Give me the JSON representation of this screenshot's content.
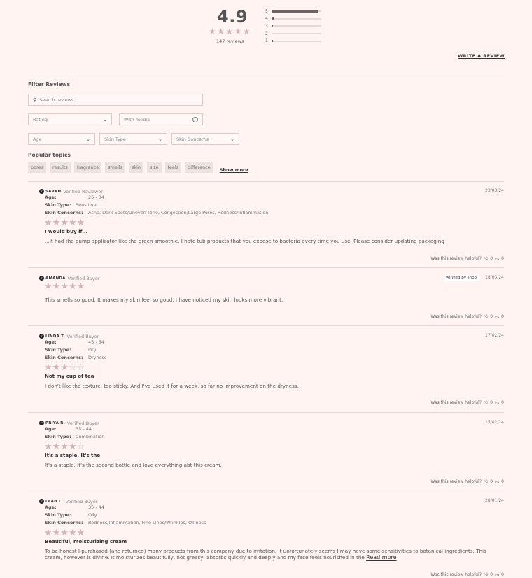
{
  "summary": {
    "score": "4.9",
    "stars": "★★★★★",
    "count": "147 reviews",
    "breakdown": [
      {
        "label": "5",
        "fraction": 0.93
      },
      {
        "label": "4",
        "fraction": 0.04
      },
      {
        "label": "3",
        "fraction": 0.02
      },
      {
        "label": "2",
        "fraction": 0.0
      },
      {
        "label": "1",
        "fraction": 0.01
      }
    ],
    "write_review": "WRITE A REVIEW"
  },
  "filters": {
    "title": "Filter Reviews",
    "search_placeholder": "Search reviews",
    "rating": "Rating",
    "with_media": "With media",
    "age": "Age",
    "skin_type": "Skin Type",
    "skin_concerns": "Skin Concerns"
  },
  "topics": {
    "title": "Popular topics",
    "chips": [
      "pores",
      "results",
      "fragrance",
      "smells",
      "skin",
      "size",
      "feels",
      "difference"
    ],
    "show_more": "Show more"
  },
  "helpful_label": "Was this review helpful?",
  "reviews": [
    {
      "author": "SARAH",
      "badge": "Verified Reviewer",
      "date": "23/03/24",
      "age_label": "Age:",
      "age": "25 - 34",
      "skin_type_label": "Skin Type:",
      "skin_type": "Sensitive",
      "concerns_label": "Skin Concerns:",
      "concerns": "Acne, Dark Spots/Uneven Tone, Congestion/Large Pores, Redness/Inflammation",
      "rating": 5,
      "title": "I would buy if...",
      "body": "...it had the pump applicator like the green smoothie. I hate tub products that you expose to bacteria every time you use. Please consider updating packaging",
      "up": "0",
      "down": "0"
    },
    {
      "author": "AMANDA",
      "badge": "Verified Buyer",
      "date": "18/03/24",
      "shop_badge": "Verified by shop",
      "rating": 5,
      "body": "This smells so good. It makes my skin feel so good. I have noticed my skin looks more vibrant.",
      "up": "0",
      "down": "0"
    },
    {
      "author": "LINDA T.",
      "badge": "Verified Buyer",
      "date": "17/02/24",
      "age_label": "Age:",
      "age": "45 - 54",
      "skin_type_label": "Skin Type:",
      "skin_type": "Dry",
      "concerns_label": "Skin Concerns:",
      "concerns": "Dryness",
      "rating": 3,
      "title": "Not my cup of tea",
      "body": "I don't like the texture, too sticky. And I've used it for a week, so far no improvement on the dryness.",
      "up": "0",
      "down": "0"
    },
    {
      "author": "PRIYA R.",
      "badge": "Verified Buyer",
      "date": "15/02/24",
      "age_label": "Age:",
      "age": "35 - 44",
      "skin_type_label": "Skin Type:",
      "skin_type": "Combination",
      "rating": 4,
      "title": "It's a staple. It's the",
      "body": "It's a staple. It's the second bottle and love everything abt this cream.",
      "up": "0",
      "down": "0"
    },
    {
      "author": "LEAH C.",
      "badge": "Verified Buyer",
      "date": "28/01/24",
      "age_label": "Age:",
      "age": "35 - 44",
      "skin_type_label": "Skin Type:",
      "skin_type": "Oily",
      "concerns_label": "Skin Concerns:",
      "concerns": "Redness/Inflammation, Fine Lines/Wrinkles, Oiliness",
      "rating": 5,
      "title": "Beautiful, moisturizing cream",
      "body": "To be honest I purchased (and returned) many products from this company due to irritation. It unfortunately seems I may have some sensitivities to botanical ingredients. This cream, however is divine. It moisturizes beautifully, not greasy, absorbs quickly and deeply and my face feels nourished in the",
      "read_more": "Read more",
      "up": "0",
      "down": "0"
    }
  ],
  "colors": {
    "background": "#fff4f1",
    "star": "#d3b4b8",
    "bar": "#666666"
  }
}
